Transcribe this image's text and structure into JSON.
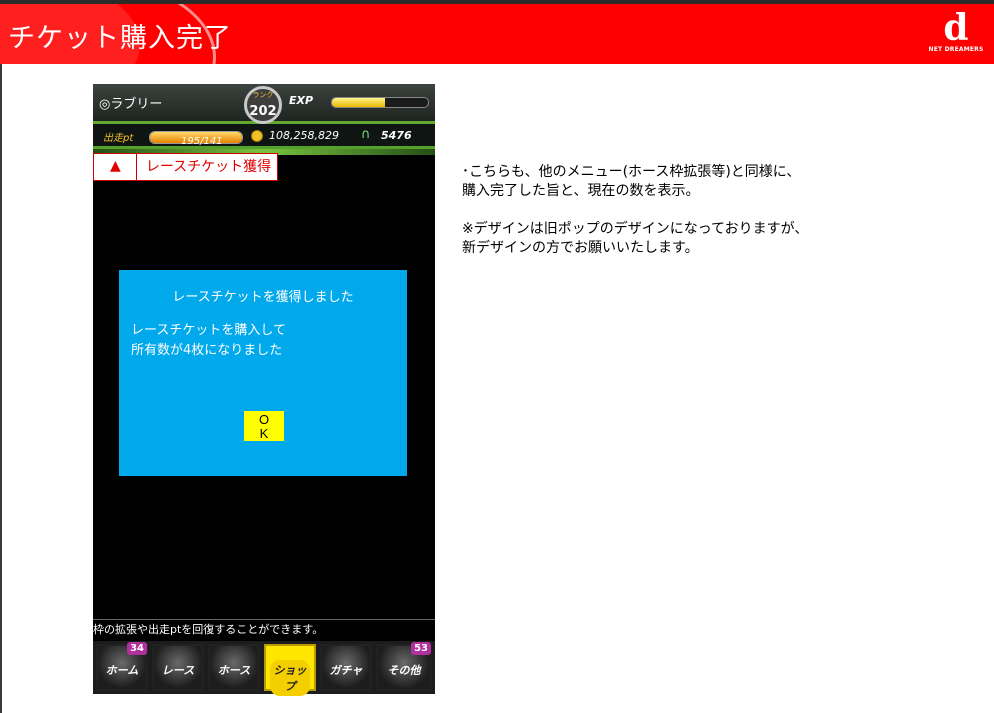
{
  "header": {
    "title": "チケット購入完了",
    "logo_text": "NET DREAMERS",
    "logo_mark": "d"
  },
  "game": {
    "player_name": "◎ラブリー",
    "rank_label": "ランク",
    "rank": "202",
    "exp_label": "EXP",
    "exp_fraction": 0.55,
    "pt_label": "出走pt",
    "pt_value": "195/141",
    "pt_fraction": 1.0,
    "gold": "108,258,829",
    "tickets": "5476"
  },
  "annotation": {
    "marker": "▲",
    "text": "レースチケット獲得"
  },
  "dialog": {
    "title": "レースチケットを獲得しました",
    "line1": "レースチケットを購入して",
    "line2": "所有数が4枚になりました",
    "ok_label": "OK",
    "ok_top": "O",
    "ok_bottom": "K"
  },
  "ticker": "枠の拡張や出走ptを回復することができます。",
  "tabs": [
    {
      "label": "ホーム",
      "badge": "34"
    },
    {
      "label": "レース",
      "badge": ""
    },
    {
      "label": "ホース",
      "badge": ""
    },
    {
      "label": "ショップ",
      "badge": "",
      "active": true
    },
    {
      "label": "ガチャ",
      "badge": ""
    },
    {
      "label": "その他",
      "badge": "53"
    }
  ],
  "notes": {
    "p1_line1": "･こちらも、他のメニュー(ホース枠拡張等)と同様に、",
    "p1_line2": "購入完了した旨と、現在の数を表示。",
    "p2_line1": "※デザインは旧ポップのデザインになっておりますが、",
    "p2_line2": "新デザインの方でお願いいたします。"
  },
  "colors": {
    "header_red": "#ff0000",
    "dialog_blue": "#00a8ec",
    "ok_yellow": "#ffff00",
    "annotation_red": "#e00000",
    "badge_purple": "#b0309e"
  }
}
